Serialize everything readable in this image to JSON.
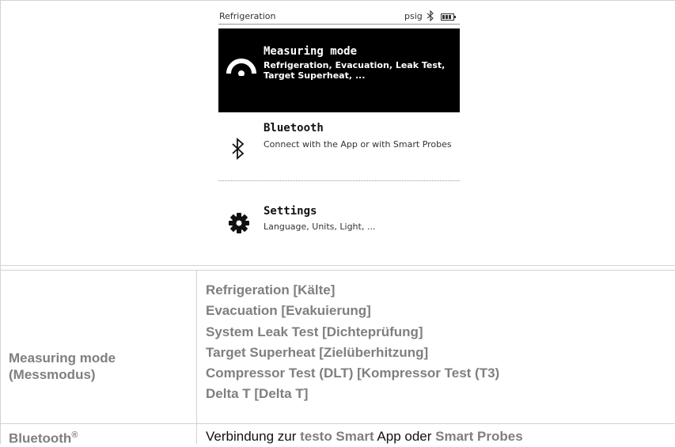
{
  "device": {
    "status_title": "Refrigeration",
    "status_unit": "psig",
    "menu": [
      {
        "title": "Measuring mode",
        "description": "Refrigeration, Evacuation, Leak Test, Target Superheat, ...",
        "icon": "gauge-icon",
        "selected": true
      },
      {
        "title": "Bluetooth",
        "description": "Connect with the App or with Smart Probes",
        "icon": "bluetooth-icon",
        "selected": false
      },
      {
        "title": "Settings",
        "description": "Language, Units, Light, ...",
        "icon": "gear-icon",
        "selected": false
      }
    ]
  },
  "table": {
    "rows": [
      {
        "label_line1": "Measuring mode",
        "label_line2": "(Messmodus)",
        "modes": [
          "Refrigeration [Kälte]",
          "Evacuation [Evakuierung]",
          "System Leak Test [Dichteprüfung]",
          "Target Superheat [Zielüberhitzung]",
          "Compressor Test (DLT) [Kompressor Test (T3)",
          "Delta T [Delta T]"
        ]
      },
      {
        "label": "Bluetooth",
        "label_sup": "®",
        "desc_part1": "Verbindung zur ",
        "desc_hl1": "testo Smart",
        "desc_part2": " App oder ",
        "desc_hl2": "Smart Probes"
      }
    ]
  },
  "colors": {
    "border": "#d2d2d2",
    "label": "#7f7f7f",
    "screen_highlight": "#000000"
  }
}
